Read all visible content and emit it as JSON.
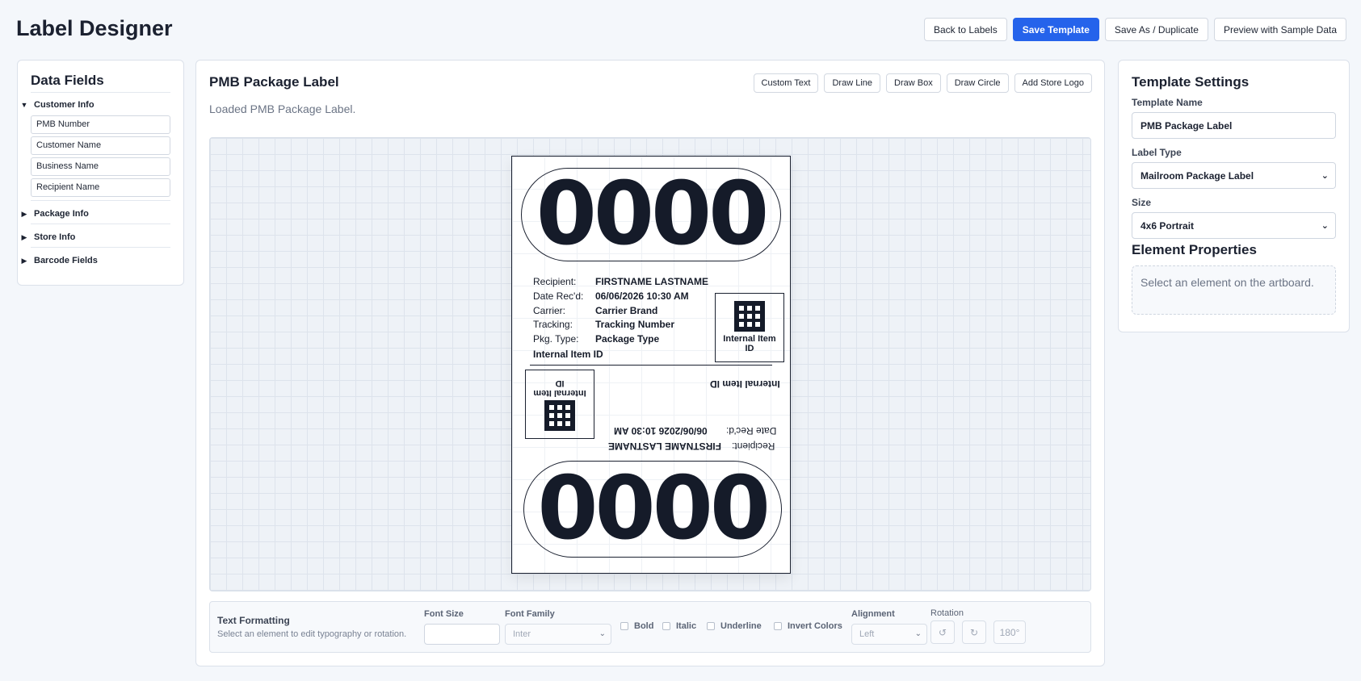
{
  "app": {
    "title": "Label Designer"
  },
  "topbar": {
    "back": "Back to Labels",
    "save": "Save Template",
    "save_as": "Save As / Duplicate",
    "preview": "Preview with Sample Data"
  },
  "data_fields": {
    "title": "Data Fields",
    "groups": [
      {
        "label": "Customer Info",
        "expanded": true,
        "items": [
          "PMB Number",
          "Customer Name",
          "Business Name",
          "Recipient Name"
        ]
      },
      {
        "label": "Package Info",
        "expanded": false
      },
      {
        "label": "Store Info",
        "expanded": false
      },
      {
        "label": "Barcode Fields",
        "expanded": false
      }
    ]
  },
  "canvas": {
    "title": "PMB Package Label",
    "status": "Loaded PMB Package Label.",
    "tools": [
      "Custom Text",
      "Draw Line",
      "Draw Box",
      "Draw Circle",
      "Add Store Logo"
    ]
  },
  "label": {
    "pmb": "0000",
    "rows": [
      {
        "key": "Recipient:",
        "value": "FIRSTNAME LASTNAME"
      },
      {
        "key": "Date Rec'd:",
        "value": "06/06/2026 10:30 AM"
      },
      {
        "key": "Carrier:",
        "value": "Carrier Brand"
      },
      {
        "key": "Tracking:",
        "value": "Tracking Number"
      },
      {
        "key": "Pkg. Type:",
        "value": "Package Type"
      }
    ],
    "internal_id": "Internal Item ID",
    "qr_label": "Internal Item ID",
    "flipped": {
      "internal_id": "Internal Item ID",
      "qr_label": "Internal Item ID",
      "date_key": "Date Rec'd:",
      "date_value": "06/06/2026 10:30 AM",
      "recipient_key": "Recipient:",
      "recipient_value": "FIRSTNAME LASTNAME"
    }
  },
  "formatting": {
    "title": "Text Formatting",
    "hint": "Select an element to edit typography or rotation.",
    "font_size_label": "Font Size",
    "font_size_value": "",
    "font_family_label": "Font Family",
    "font_family_value": "Inter",
    "bold": "Bold",
    "italic": "Italic",
    "underline": "Underline",
    "invert": "Invert Colors",
    "alignment_label": "Alignment",
    "alignment_value": "Left",
    "rotation_label": "Rotation",
    "rotation_value": "180°"
  },
  "settings": {
    "title": "Template Settings",
    "name_label": "Template Name",
    "name_value": "PMB Package Label",
    "type_label": "Label Type",
    "type_value": "Mailroom Package Label",
    "size_label": "Size",
    "size_value": "4x6 Portrait",
    "element_title": "Element Properties",
    "element_empty": "Select an element on the artboard."
  }
}
